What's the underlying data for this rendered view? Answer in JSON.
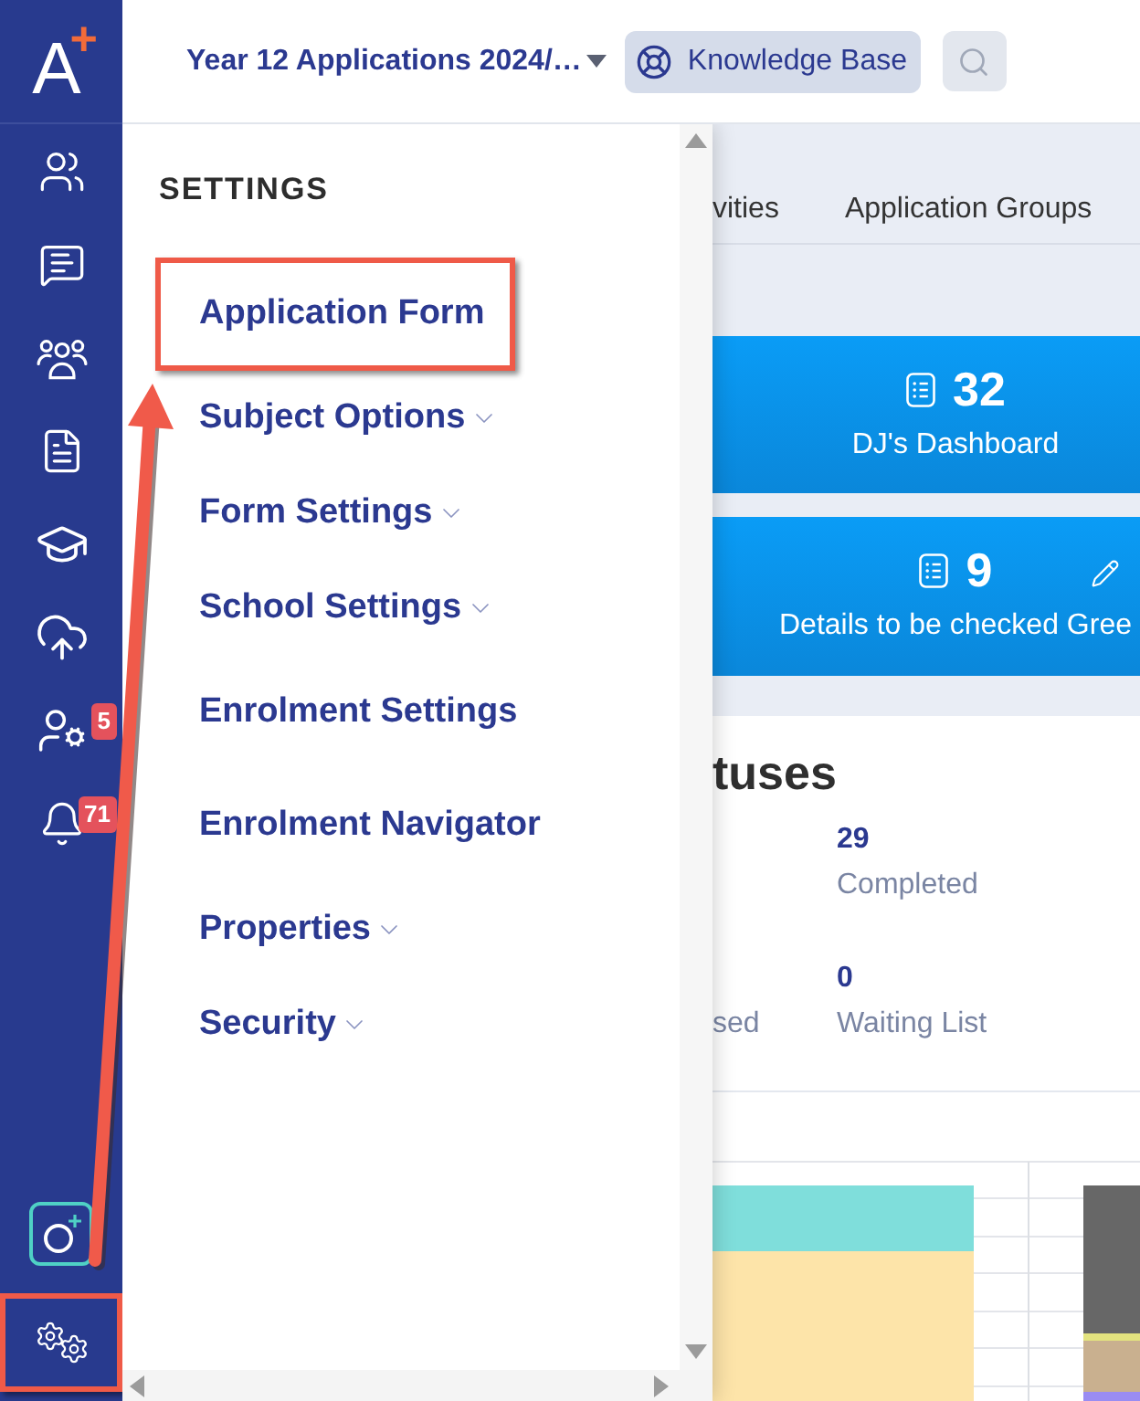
{
  "sidebar": {
    "logo": {
      "letter": "A",
      "mark": "+"
    },
    "items": [
      {
        "kind": "people"
      },
      {
        "kind": "chat"
      },
      {
        "kind": "group"
      },
      {
        "kind": "document"
      },
      {
        "kind": "graduation"
      },
      {
        "kind": "upload"
      },
      {
        "kind": "staff",
        "badge": "5"
      },
      {
        "kind": "notifications",
        "badge": "71"
      }
    ],
    "bottom_items": [
      {
        "kind": "add",
        "highlighted": false
      },
      {
        "kind": "settings",
        "highlighted": true
      }
    ]
  },
  "top_bar": {
    "selector": {
      "label": "Year 12 Applications 2024/…"
    },
    "knowledge_base": {
      "label": "Knowledge Base"
    }
  },
  "tabs": [
    {
      "label": "vities"
    },
    {
      "label": "Application Groups"
    }
  ],
  "cards": [
    {
      "stats": [
        {
          "kind": "list",
          "value": "32",
          "label": "DJ's Dashboard"
        }
      ]
    },
    {
      "stats": [
        {
          "kind": "list",
          "value": "9",
          "label": "Details to be checked Gree"
        },
        {
          "kind": "edit"
        }
      ]
    }
  ],
  "statuses": {
    "title": "tuses",
    "rows": [
      {
        "value": "29",
        "label": "Completed"
      },
      {
        "side_label": "sed",
        "value": "0",
        "label": "Waiting List"
      }
    ]
  },
  "settings_menu": {
    "title": "SETTINGS",
    "items": [
      {
        "label": "Application Form",
        "has_submenu": false,
        "highlighted": true
      },
      {
        "label": "Subject Options",
        "has_submenu": true,
        "highlighted": false
      },
      {
        "label": "Form Settings",
        "has_submenu": true,
        "highlighted": false
      },
      {
        "label": "School Settings",
        "has_submenu": true,
        "highlighted": false
      },
      {
        "label": "Enrolment Settings",
        "has_submenu": false,
        "highlighted": false
      },
      {
        "label": "Enrolment Navigator",
        "has_submenu": false,
        "highlighted": false
      },
      {
        "label": "Properties",
        "has_submenu": true,
        "highlighted": false
      },
      {
        "label": "Security",
        "has_submenu": true,
        "highlighted": false
      }
    ]
  }
}
